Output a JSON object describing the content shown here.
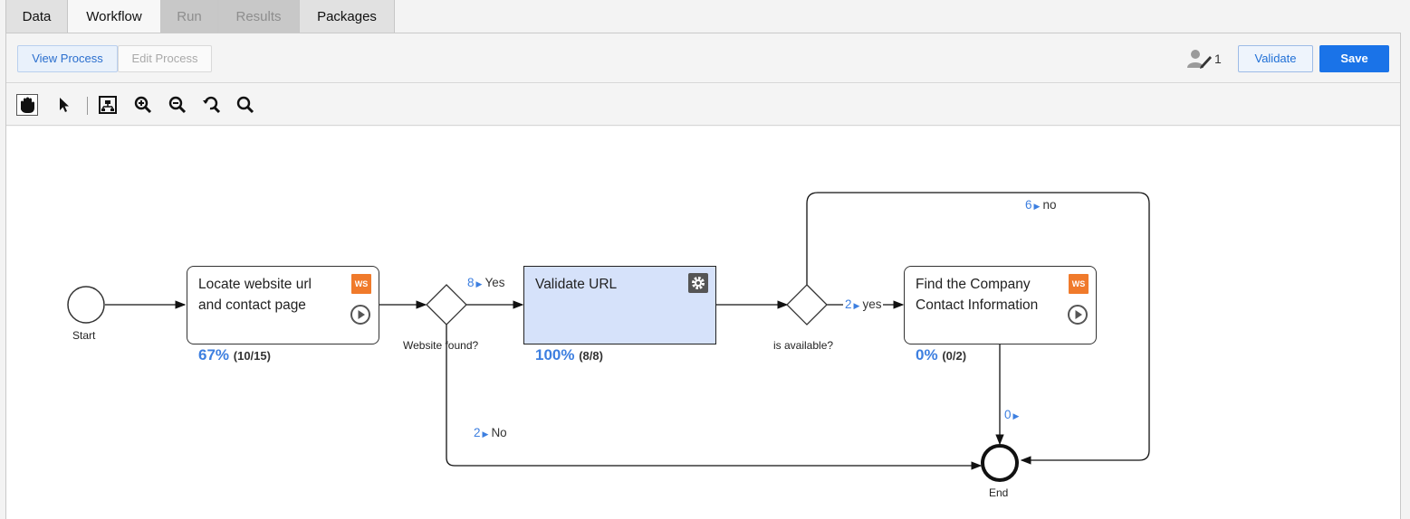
{
  "tabs": [
    {
      "label": "Data",
      "state": "normal"
    },
    {
      "label": "Workflow",
      "state": "active"
    },
    {
      "label": "Run",
      "state": "disabled"
    },
    {
      "label": "Results",
      "state": "disabled"
    },
    {
      "label": "Packages",
      "state": "normal"
    }
  ],
  "header": {
    "view_process": "View Process",
    "edit_process": "Edit Process",
    "editor_count": "1",
    "validate": "Validate",
    "save": "Save"
  },
  "toolbar": {
    "tools": [
      "hand-pan-icon",
      "pointer-icon",
      "fit-to-screen-icon",
      "zoom-in-icon",
      "zoom-out-icon",
      "zoom-reset-icon",
      "zoom-icon"
    ]
  },
  "diagram": {
    "start_label": "Start",
    "end_label": "End",
    "tasks": [
      {
        "line1": "Locate website url",
        "line2": "and contact page",
        "badge": "WS",
        "percent": "67%",
        "count": "(10/15)"
      },
      {
        "line1": "Validate URL",
        "line2": "",
        "percent": "100%",
        "count": "(8/8)"
      },
      {
        "line1": "Find the Company",
        "line2": "Contact Information",
        "badge": "WS",
        "percent": "0%",
        "count": "(0/2)"
      }
    ],
    "gateways": [
      {
        "label": "Website found?"
      },
      {
        "label": "is available?"
      }
    ],
    "flows": [
      {
        "count": "8",
        "label": "Yes"
      },
      {
        "count": "2",
        "label": "No"
      },
      {
        "count": "2",
        "label": "yes"
      },
      {
        "count": "6",
        "label": "no"
      },
      {
        "count": "0",
        "label": ""
      }
    ]
  },
  "colors": {
    "accent": "#1a73e8",
    "progress": "#3d7fe0",
    "ws_badge": "#f07a2b",
    "highlight_task": "#d6e2fa"
  }
}
